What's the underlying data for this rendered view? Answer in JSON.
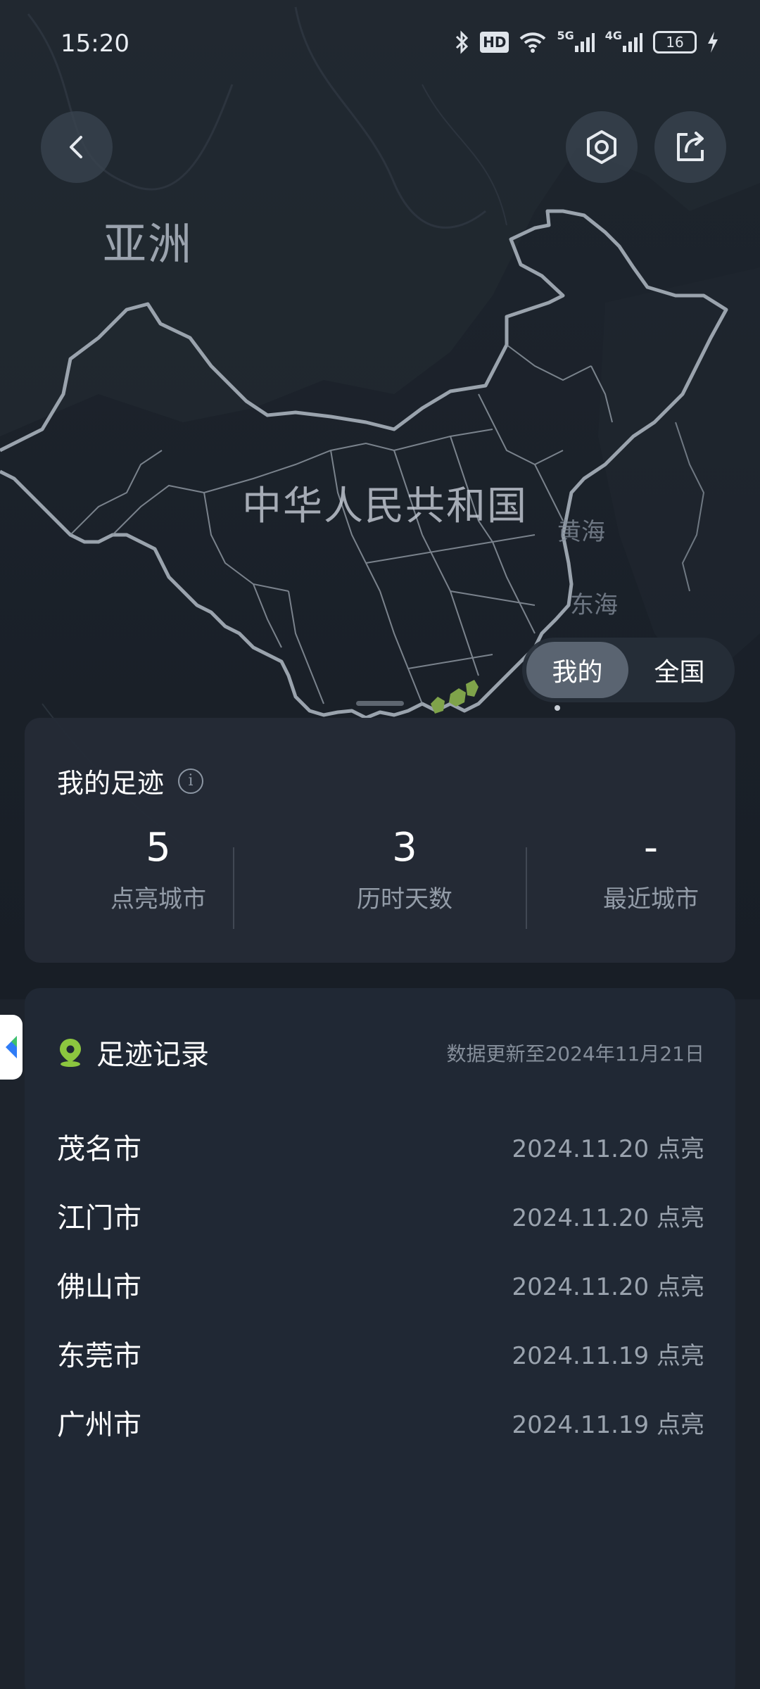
{
  "status_bar": {
    "time": "15:20",
    "hd_label": "HD",
    "signal_1_label": "5G",
    "signal_2_label": "4G",
    "battery_level": "16",
    "icons": [
      "bluetooth-icon",
      "hd-icon",
      "wifi-icon",
      "signal-5g-icon",
      "signal-4g-icon",
      "battery-icon",
      "charging-icon"
    ]
  },
  "toolbar": {
    "back_icon": "chevron-left-icon",
    "settings_icon": "settings-icon",
    "share_icon": "share-icon"
  },
  "map": {
    "continent_label": "亚洲",
    "country_label": "中华人民共和国",
    "sea_labels": [
      "黄海",
      "东海"
    ],
    "background_color": "#1c232c",
    "border_color": "#9aa3ad",
    "highlight_color": "#7fa34a"
  },
  "toggle": {
    "options": [
      "我的",
      "全国"
    ],
    "selected": "我的"
  },
  "footprint": {
    "title": "我的足迹",
    "info_icon": "info-icon",
    "stats": [
      {
        "value": "5",
        "label": "点亮城市"
      },
      {
        "value": "3",
        "label": "历时天数"
      },
      {
        "value": "-",
        "label": "最近城市"
      }
    ]
  },
  "records": {
    "title": "足迹记录",
    "title_icon": "location-pin-icon",
    "updated": "数据更新至2024年11月21日",
    "items": [
      {
        "city": "茂名市",
        "date": "2024.11.20 点亮"
      },
      {
        "city": "江门市",
        "date": "2024.11.20 点亮"
      },
      {
        "city": "佛山市",
        "date": "2024.11.20 点亮"
      },
      {
        "city": "东莞市",
        "date": "2024.11.19 点亮"
      },
      {
        "city": "广州市",
        "date": "2024.11.19 点亮"
      }
    ]
  },
  "colors": {
    "accent_green": "#8cc63f",
    "card_bg": "#242b36",
    "text_secondary": "#939ca8"
  }
}
